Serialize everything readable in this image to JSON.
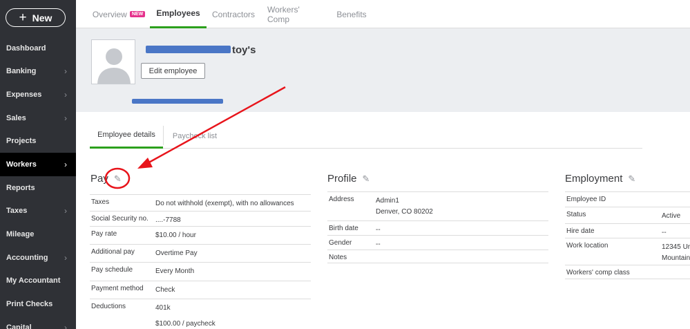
{
  "sidebar": {
    "new_label": "New",
    "items": [
      {
        "label": "Dashboard",
        "chevron": false
      },
      {
        "label": "Banking",
        "chevron": true
      },
      {
        "label": "Expenses",
        "chevron": true
      },
      {
        "label": "Sales",
        "chevron": true
      },
      {
        "label": "Projects",
        "chevron": false
      },
      {
        "label": "Workers",
        "chevron": true,
        "active": true
      },
      {
        "label": "Reports",
        "chevron": false
      },
      {
        "label": "Taxes",
        "chevron": true
      },
      {
        "label": "Mileage",
        "chevron": false
      },
      {
        "label": "Accounting",
        "chevron": true
      },
      {
        "label": "My Accountant",
        "chevron": false
      },
      {
        "label": "Print Checks",
        "chevron": false
      },
      {
        "label": "Capital",
        "chevron": true
      }
    ]
  },
  "top_tabs": {
    "overview": "Overview",
    "overview_badge": "NEW",
    "employees": "Employees",
    "contractors": "Contractors",
    "workers_comp": "Workers' Comp",
    "benefits": "Benefits"
  },
  "header": {
    "employee_name_visible": "toy's",
    "edit_button": "Edit employee"
  },
  "sub_tabs": {
    "details": "Employee details",
    "paycheck_list": "Paycheck list"
  },
  "pay": {
    "title": "Pay",
    "rows": [
      {
        "label": "Taxes",
        "value": "Do not withhold (exempt), with no allowances"
      },
      {
        "label": "Social Security no.",
        "value": "....-7788"
      },
      {
        "label": "Pay rate",
        "value": "$10.00 / hour"
      },
      {
        "label": "Additional pay",
        "value": "Overtime Pay"
      },
      {
        "label": "Pay schedule",
        "value": "Every Month"
      },
      {
        "label": "Payment method",
        "value": "Check"
      },
      {
        "label": "Deductions",
        "value": "401k",
        "value2": "$100.00 / paycheck"
      }
    ]
  },
  "profile": {
    "title": "Profile",
    "rows": [
      {
        "label": "Address",
        "value": "Admin1",
        "value2": "Denver, CO 80202"
      },
      {
        "label": "Birth date",
        "value": "--"
      },
      {
        "label": "Gender",
        "value": "--"
      },
      {
        "label": "Notes",
        "value": ""
      }
    ]
  },
  "employment": {
    "title": "Employment",
    "rows": [
      {
        "label": "Employee ID",
        "value": ""
      },
      {
        "label": "Status",
        "value": "Active"
      },
      {
        "label": "Hire date",
        "value": "--"
      },
      {
        "label": "Work location",
        "value": "12345 Ur",
        "value2": "Mountain"
      },
      {
        "label": "Workers' comp class",
        "value": ""
      }
    ]
  },
  "colors": {
    "sidebar_bg": "#2f3136",
    "accent_green": "#2ca01c",
    "badge_pink": "#e5318c",
    "annotation_red": "#e8141b",
    "redaction_blue": "#4a76c6"
  },
  "icons": {
    "pencil": "edit-pencil-icon",
    "plus": "plus-icon",
    "chevron": "chevron-right-icon"
  }
}
